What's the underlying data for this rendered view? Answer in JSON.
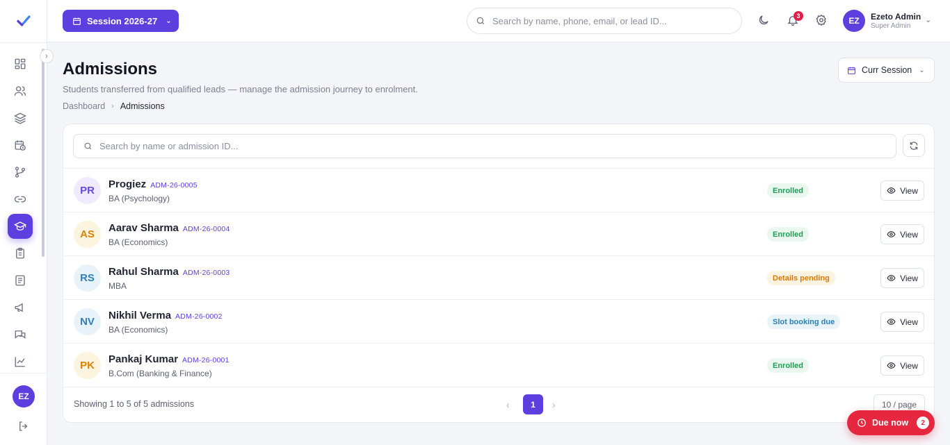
{
  "topbar": {
    "session_label": "Session 2026-27",
    "search_placeholder": "Search by name, phone, email, or lead ID...",
    "notifications_count": "3",
    "user": {
      "initials": "EZ",
      "name": "Ezeto Admin",
      "role": "Super Admin"
    }
  },
  "sidebar": {
    "items": [
      {
        "name": "sidebar-item-dashboard",
        "icon": "grid-icon"
      },
      {
        "name": "sidebar-item-users",
        "icon": "users-icon"
      },
      {
        "name": "sidebar-item-layers",
        "icon": "layers-icon"
      },
      {
        "name": "sidebar-item-schedule",
        "icon": "calendar-clock-icon"
      },
      {
        "name": "sidebar-item-pipeline",
        "icon": "git-branch-icon"
      },
      {
        "name": "sidebar-item-links",
        "icon": "link-icon"
      },
      {
        "name": "sidebar-item-admissions",
        "icon": "graduation-cap-icon",
        "active": true
      },
      {
        "name": "sidebar-item-tasks",
        "icon": "clipboard-icon"
      },
      {
        "name": "sidebar-item-documents",
        "icon": "document-icon"
      },
      {
        "name": "sidebar-item-campaigns",
        "icon": "megaphone-icon"
      },
      {
        "name": "sidebar-item-messages",
        "icon": "chat-icon"
      },
      {
        "name": "sidebar-item-reports",
        "icon": "chart-icon"
      }
    ],
    "user_initials": "EZ"
  },
  "page": {
    "title": "Admissions",
    "subtitle": "Students transferred from qualified leads — manage the admission journey to enrolment.",
    "breadcrumb": {
      "home": "Dashboard",
      "current": "Admissions"
    },
    "session_filter": "Curr Session"
  },
  "list": {
    "search_placeholder": "Search by name or admission ID...",
    "view_label": "View",
    "rows": [
      {
        "initials": "PR",
        "name": "Progiez",
        "id": "ADM-26-0005",
        "course": "BA (Psychology)",
        "status": "Enrolled"
      },
      {
        "initials": "AS",
        "name": "Aarav Sharma",
        "id": "ADM-26-0004",
        "course": "BA (Economics)",
        "status": "Enrolled"
      },
      {
        "initials": "RS",
        "name": "Rahul Sharma",
        "id": "ADM-26-0003",
        "course": "MBA",
        "status": "Details pending"
      },
      {
        "initials": "NV",
        "name": "Nikhil Verma",
        "id": "ADM-26-0002",
        "course": "BA (Economics)",
        "status": "Slot booking due"
      },
      {
        "initials": "PK",
        "name": "Pankaj Kumar",
        "id": "ADM-26-0001",
        "course": "B.Com (Banking & Finance)",
        "status": "Enrolled"
      }
    ],
    "footer": {
      "showing": "Showing 1 to 5 of 5 admissions",
      "page": "1",
      "per_page": "10 / page"
    }
  },
  "due_now": {
    "label": "Due now",
    "count": "2"
  },
  "colors": {
    "accent": "#5b3fdf",
    "enrolled": "#1f9d55",
    "pending": "#d97a06",
    "slot": "#2a7fb8",
    "due": "#e5273f"
  }
}
